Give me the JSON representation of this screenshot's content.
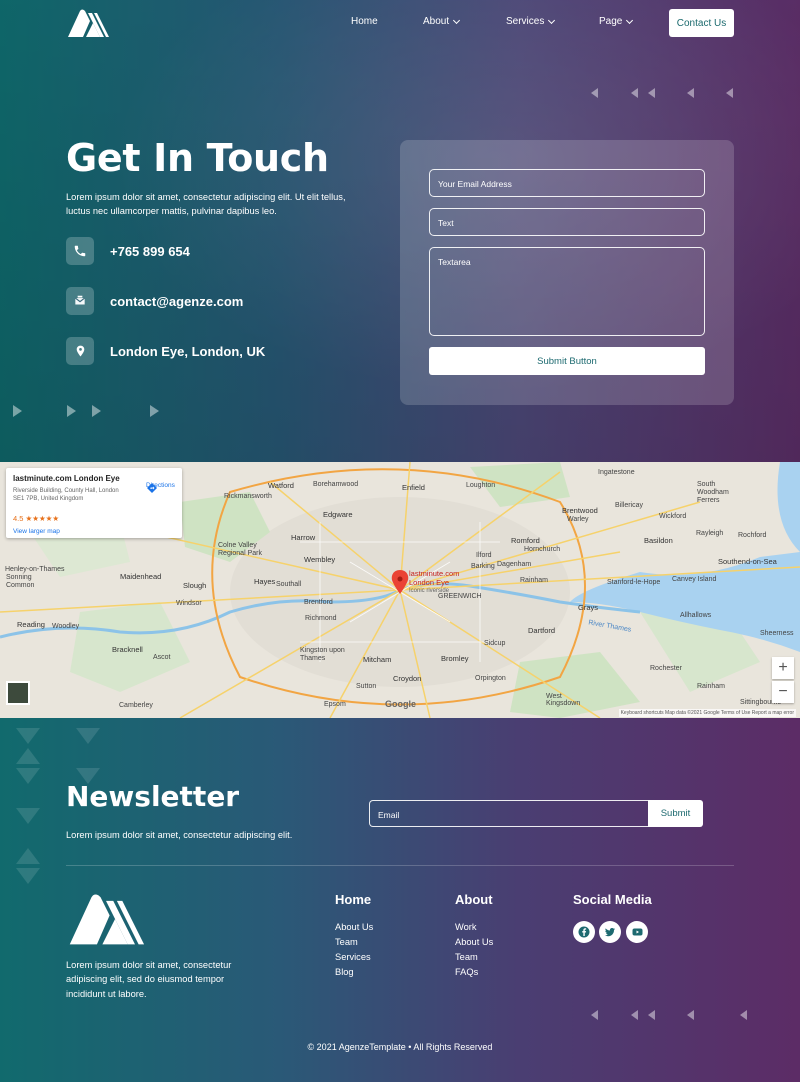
{
  "nav": {
    "items": [
      {
        "label": "Home"
      },
      {
        "label": "About"
      },
      {
        "label": "Services"
      },
      {
        "label": "Page"
      }
    ],
    "cta": "Contact Us"
  },
  "hero": {
    "title": "Get In Touch",
    "description": "Lorem ipsum dolor sit amet, consectetur adipiscing elit. Ut elit tellus, luctus nec ullamcorper mattis, pulvinar dapibus leo.",
    "contacts": [
      {
        "icon": "phone-icon",
        "text": "+765 899 654"
      },
      {
        "icon": "envelope-icon",
        "text": "contact@agenze.com"
      },
      {
        "icon": "location-pin-icon",
        "text": "London Eye, London, UK"
      }
    ]
  },
  "form": {
    "email_placeholder": "Your Email Address",
    "text_placeholder": "Text",
    "textarea_placeholder": "Textarea",
    "submit_label": "Submit Button"
  },
  "map": {
    "place_name": "lastminute.com London Eye",
    "address": "Riverside Building, County Hall, London SE1 7PB, United Kingdom",
    "rating": "4.5 ★★★★★",
    "directions": "Directions",
    "larger_map": "View larger map",
    "pin_label": "lastminute.com London Eye",
    "pin_sublabel": "Iconic riverside",
    "google": "Google",
    "footer": "Keyboard shortcuts   Map data ©2021 Google   Terms of Use   Report a map error",
    "places": [
      "Watford",
      "Enfield",
      "Loughton",
      "Ingatestone",
      "Edgware",
      "Brentwood",
      "Billericay",
      "Harrow",
      "Wembley",
      "Romford",
      "Hornchurch",
      "Basildon",
      "Rayleigh",
      "Rochford",
      "Southend-on-Sea",
      "Maidenhead",
      "Slough",
      "Hayes",
      "Southall",
      "Brentford",
      "Ilford",
      "Barking",
      "Dagenham",
      "Rainham",
      "Stanford-le-Hope",
      "Canvey Island",
      "Windsor",
      "Grays",
      "Reading",
      "Woodley",
      "Richmond",
      "GREENWICH",
      "Dartford",
      "Allhallows",
      "Sheerness",
      "Bracknell",
      "Ascot",
      "Kingston upon Thames",
      "Mitcham",
      "Bromley",
      "Sidcup",
      "Rochester",
      "Croydon",
      "Sutton",
      "Orpington",
      "Epsom",
      "Camberley",
      "West Kingsdown",
      "Sittingbourne",
      "Rainham",
      "Henley-on-Thames",
      "Sonning Common",
      "Colne Valley Regional Park",
      "Rickmansworth",
      "Borehamwood",
      "Wickford",
      "River Thames",
      "South Woodham Ferrers",
      "Warley"
    ]
  },
  "newsletter": {
    "title": "Newsletter",
    "description": "Lorem ipsum dolor sit amet, consectetur adipiscing elit.",
    "email_placeholder": "Email",
    "submit_label": "Submit"
  },
  "footer": {
    "description": "Lorem ipsum dolor sit amet, consectetur adipiscing elit, sed do eiusmod tempor incididunt ut labore.",
    "columns": [
      {
        "title": "Home",
        "links": [
          "About Us",
          "Team",
          "Services",
          "Blog"
        ]
      },
      {
        "title": "About",
        "links": [
          "Work",
          "About Us",
          "Team",
          "FAQs"
        ]
      }
    ],
    "social_title": "Social Media",
    "social": [
      "facebook-icon",
      "twitter-icon",
      "youtube-icon"
    ],
    "copyright": "© 2021 AgenzeTemplate • All Rights Reserved"
  },
  "colors": {
    "teal": "#0f6b6e",
    "purple": "#5e2f6a",
    "button_text": "#1d6a70"
  }
}
